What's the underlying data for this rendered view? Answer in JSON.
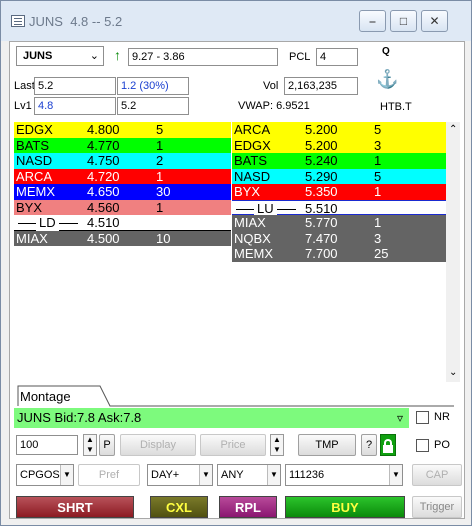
{
  "title": {
    "symbol": "JUNS",
    "range": "4.8 -- 5.2"
  },
  "header": {
    "symbol": "JUNS",
    "range": "9.27 - 3.86",
    "pcl_label": "PCL",
    "pcl_value": "4",
    "q_label": "Q",
    "last_label": "Last",
    "last_value": "5.2",
    "change": "1.2  (30%)",
    "vol_label": "Vol",
    "vol_value": "2,163,235",
    "lv1_label": "Lv1",
    "lv1_value": "4.8",
    "lv1_value2": "5.2",
    "vwap": "VWAP: 6.9521",
    "htb": "HTB.T"
  },
  "colors": {
    "yellow": "#ffff00",
    "green": "#00ff00",
    "cyan": "#00ffff",
    "red": "#ff0000",
    "blue": "#0000ff",
    "pink": "#f08080",
    "gray": "#646464",
    "white": "#ffffff",
    "bidask_bg": "#7dfa7d"
  },
  "bids": [
    {
      "mm": "EDGX",
      "price": "4.800",
      "size": "5",
      "color": "yellow",
      "text": "#000000"
    },
    {
      "mm": "BATS",
      "price": "4.770",
      "size": "1",
      "color": "green",
      "text": "#000000"
    },
    {
      "mm": "NASD",
      "price": "4.750",
      "size": "2",
      "color": "cyan",
      "text": "#000000"
    },
    {
      "mm": "ARCA",
      "price": "4.720",
      "size": "1",
      "color": "red",
      "text": "#ffffff"
    },
    {
      "mm": "MEMX",
      "price": "4.650",
      "size": "30",
      "color": "blue",
      "text": "#ffffff"
    },
    {
      "mm": "BYX",
      "price": "4.560",
      "size": "1",
      "color": "pink",
      "text": "#000000"
    },
    {
      "mm": "LD",
      "price": "4.510",
      "size": "",
      "color": "white",
      "text": "#000000",
      "limit": true
    },
    {
      "mm": "MIAX",
      "price": "4.500",
      "size": "10",
      "color": "gray",
      "text": "#ffffff"
    }
  ],
  "asks": [
    {
      "mm": "ARCA",
      "price": "5.200",
      "size": "5",
      "color": "yellow",
      "text": "#000000"
    },
    {
      "mm": "EDGX",
      "price": "5.200",
      "size": "3",
      "color": "yellow",
      "text": "#000000"
    },
    {
      "mm": "BATS",
      "price": "5.240",
      "size": "1",
      "color": "green",
      "text": "#000000"
    },
    {
      "mm": "NASD",
      "price": "5.290",
      "size": "5",
      "color": "cyan",
      "text": "#000000"
    },
    {
      "mm": "BYX",
      "price": "5.350",
      "size": "1",
      "color": "red",
      "text": "#ffffff"
    },
    {
      "mm": "LU",
      "price": "5.510",
      "size": "",
      "color": "white",
      "text": "#000000",
      "limit": true
    },
    {
      "mm": "MIAX",
      "price": "5.770",
      "size": "1",
      "color": "gray",
      "text": "#ffffff"
    },
    {
      "mm": "NQBX",
      "price": "7.470",
      "size": "3",
      "color": "gray",
      "text": "#ffffff"
    },
    {
      "mm": "MEMX",
      "price": "7.700",
      "size": "25",
      "color": "gray",
      "text": "#ffffff"
    }
  ],
  "tabs": {
    "montage": "Montage"
  },
  "bidask": "JUNS Bid:7.8 Ask:7.8",
  "order": {
    "nr_label": "NR",
    "po_label": "PO",
    "qty": "100",
    "p_label": "P",
    "display_label": "Display",
    "price_label": "Price",
    "tmp_label": "TMP",
    "help_label": "?",
    "route": "CPGOSI",
    "pref_label": "Pref",
    "tif": "DAY+",
    "type": "ANY",
    "account": "111236",
    "cap_label": "CAP"
  },
  "actions": {
    "shrt": "SHRT",
    "cxl": "CXL",
    "rpl": "RPL",
    "buy": "BUY",
    "trigger": "Trigger"
  }
}
